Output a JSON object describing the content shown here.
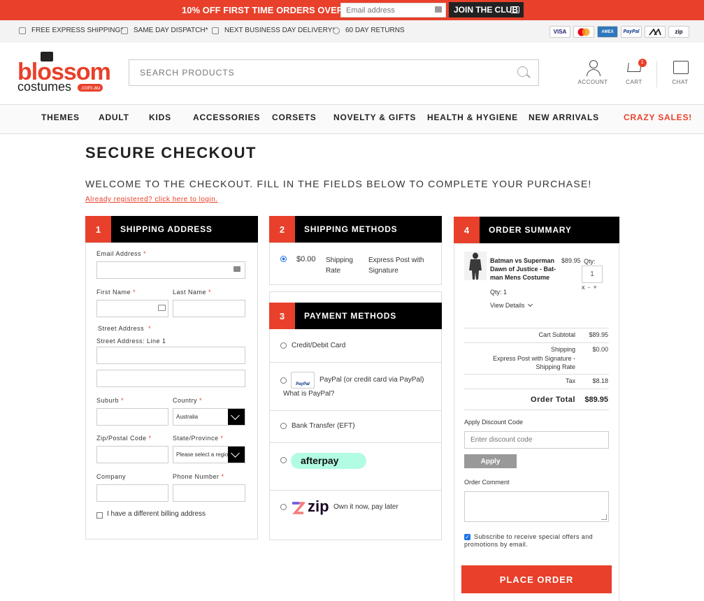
{
  "promo": {
    "text": "10% OFF FIRST TIME ORDERS OVER $85",
    "email_placeholder": "Email address",
    "join_label": "JOIN THE CLUB"
  },
  "usps": [
    {
      "icon": "dollar-icon",
      "label": "FREE EXPRESS SHIPPING*"
    },
    {
      "icon": "box-icon",
      "label": "SAME DAY DISPATCH*"
    },
    {
      "icon": "truck-icon",
      "label": "NEXT BUSINESS DAY DELIVERY*"
    },
    {
      "icon": "returns-icon",
      "label": "60 DAY RETURNS"
    }
  ],
  "payment_badges": [
    "VISA",
    "Mastercard",
    "AMEX",
    "PayPal",
    "Afterpay",
    "zip"
  ],
  "logo": {
    "word1": "blossom",
    "word2": "costumes",
    "tag": ".com.au"
  },
  "search": {
    "placeholder": "SEARCH PRODUCTS"
  },
  "header": {
    "account_label": "ACCOUNT",
    "cart_label": "CART",
    "cart_count": "1",
    "chat_label": "CHAT"
  },
  "nav": [
    "THEMES",
    "ADULT",
    "KIDS",
    "ACCESSORIES",
    "CORSETS",
    "NOVELTY & GIFTS",
    "HEALTH & HYGIENE",
    "NEW ARRIVALS",
    "CRAZY SALES!"
  ],
  "colors": {
    "accent": "#e8402a",
    "dark": "#000000"
  },
  "page": {
    "title": "SECURE CHECKOUT",
    "welcome": "WELCOME TO THE CHECKOUT. FILL IN THE FIELDS BELOW TO COMPLETE YOUR PURCHASE!",
    "login_link": "Already registered? click here to login."
  },
  "shipping_address": {
    "num": "1",
    "title": "SHIPPING ADDRESS",
    "email_label": "Email Address",
    "first_name_label": "First Name",
    "last_name_label": "Last Name",
    "street_label": "Street Address",
    "street_line1_label": "Street Address: Line 1",
    "suburb_label": "Suburb",
    "country_label": "Country",
    "country_value": "Australia",
    "zip_label": "Zip/Postal Code",
    "state_label": "State/Province",
    "state_placeholder": "Please select a region",
    "company_label": "Company",
    "phone_label": "Phone Number",
    "billing_checkbox_label": "I have a different billing address",
    "required_mark": "*"
  },
  "shipping_methods": {
    "num": "2",
    "title": "SHIPPING METHODS",
    "price": "$0.00",
    "rate": "Shipping Rate",
    "carrier": "Express Post with Signature"
  },
  "payment_methods": {
    "num": "3",
    "title": "PAYMENT METHODS",
    "card": "Credit/Debit Card",
    "paypal": "PayPal (or credit card via PayPal)",
    "paypal_badge": "PayPal",
    "paypal_what": "What is PayPal?",
    "bank": "Bank Transfer (EFT)",
    "afterpay": "afterpay",
    "zip_logo": "zip",
    "zip_text": "Own it now, pay later"
  },
  "order_summary": {
    "num": "4",
    "title": "ORDER SUMMARY",
    "item": {
      "name": "Batman vs Superman Dawn of Justice - Bat-man Mens Costume",
      "price": "$89.95",
      "qty_label": "Qty:",
      "qty_value": "1",
      "qty_controls": "x - +",
      "qty_line": "Qty: 1",
      "view_details": "View Details"
    },
    "cart_subtotal_label": "Cart Subtotal",
    "cart_subtotal": "$89.95",
    "shipping_label": "Shipping",
    "shipping_desc": "Express Post with Signature - Shipping Rate",
    "shipping_value": "$0.00",
    "tax_label": "Tax",
    "tax_value": "$8.18",
    "total_label": "Order Total",
    "total_value": "$89.95",
    "discount_label": "Apply Discount Code",
    "discount_placeholder": "Enter discount code",
    "apply_label": "Apply",
    "comment_label": "Order Comment",
    "subscribe_label": "Subscribe to receive special offers and promotions by email.",
    "place_order": "PLACE ORDER"
  }
}
